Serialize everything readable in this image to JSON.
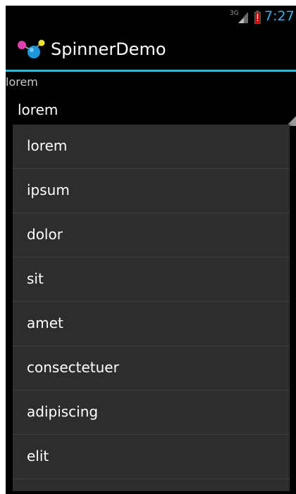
{
  "status_bar": {
    "network_type": "3G",
    "time": "7:27",
    "icons": [
      "signal-icon",
      "battery-alert-icon"
    ],
    "accent_color": "#33b5e5"
  },
  "action_bar": {
    "app_icon": "app-launcher-icon",
    "title": "SpinnerDemo"
  },
  "selection_label": "lorem",
  "spinner": {
    "selected_value": "lorem",
    "options": [
      "lorem",
      "ipsum",
      "dolor",
      "sit",
      "amet",
      "consectetuer",
      "adipiscing",
      "elit"
    ]
  }
}
